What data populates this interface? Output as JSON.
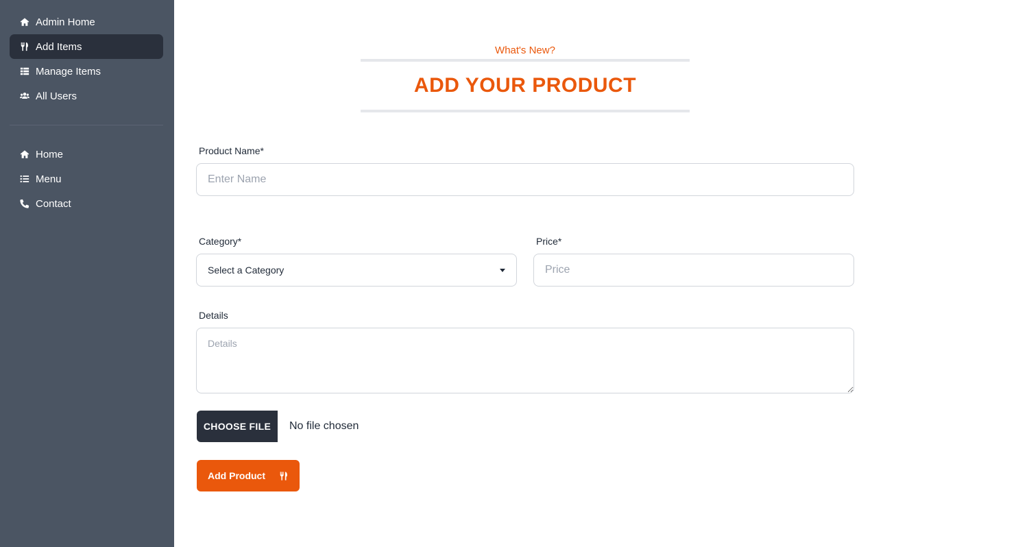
{
  "sidebar": {
    "admin_items": [
      {
        "label": "Admin Home",
        "icon": "home-icon",
        "active": false
      },
      {
        "label": "Add Items",
        "icon": "utensils-icon",
        "active": true
      },
      {
        "label": "Manage Items",
        "icon": "list-table-icon",
        "active": false
      },
      {
        "label": "All Users",
        "icon": "users-icon",
        "active": false
      }
    ],
    "site_items": [
      {
        "label": "Home",
        "icon": "home-icon"
      },
      {
        "label": "Menu",
        "icon": "list-icon"
      },
      {
        "label": "Contact",
        "icon": "phone-icon"
      }
    ]
  },
  "header": {
    "subheading": "What's New?",
    "title": "ADD YOUR PRODUCT"
  },
  "form": {
    "name_label": "Product Name*",
    "name_placeholder": "Enter Name",
    "category_label": "Category*",
    "category_selected": "Select a Category",
    "price_label": "Price*",
    "price_placeholder": "Price",
    "details_label": "Details",
    "details_placeholder": "Details",
    "file_button": "CHOOSE FILE",
    "file_status": "No file chosen",
    "submit_label": "Add Product",
    "submit_icon": "utensils-icon"
  },
  "colors": {
    "sidebar_bg": "#4b5563",
    "active_bg": "#2a303c",
    "accent": "#ea580c"
  }
}
